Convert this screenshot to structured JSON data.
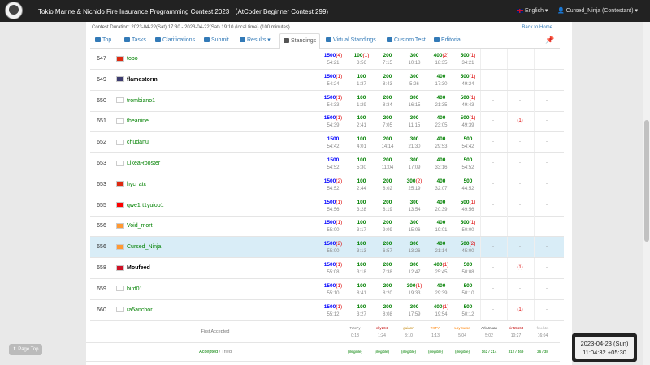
{
  "navbar": {
    "logo_text": "AtCoder",
    "title": "Tokio Marine & Nichido Fire Insurance Programming Contest 2023 （AtCoder Beginner Contest 299)",
    "language": "English",
    "user": "Cursed_Ninja (Contestant)"
  },
  "contest": {
    "duration": "Contest Duration: 2023-04-22(Sat) 17:30 - 2023-04-22(Sat) 19:10 (local time) (100 minutes)",
    "back_home": "Back to Home"
  },
  "tabs": [
    {
      "label": "Top",
      "icon": "home-icon"
    },
    {
      "label": "Tasks",
      "icon": "tasks-icon"
    },
    {
      "label": "Clarifications",
      "icon": "question-icon"
    },
    {
      "label": "Submit",
      "icon": "send-icon"
    },
    {
      "label": "Results",
      "icon": "list-icon"
    },
    {
      "label": "Standings",
      "icon": "sort-icon"
    },
    {
      "label": "Virtual Standings",
      "icon": "sort-icon"
    },
    {
      "label": "Custom Test",
      "icon": "wrench-icon"
    },
    {
      "label": "Editorial",
      "icon": "book-icon"
    }
  ],
  "rows": [
    {
      "rank": "647",
      "name": "tobo",
      "color": "#008000",
      "flag": "#de2910",
      "total": "1500",
      "tpen": "(4)",
      "ttime": "54:21",
      "a": [
        "100",
        "(1)",
        "3:56"
      ],
      "b": [
        "200",
        "",
        "7:15"
      ],
      "c": [
        "300",
        "",
        "10:18"
      ],
      "d": [
        "400",
        "(2)",
        "18:35"
      ],
      "e": [
        "500",
        "(1)",
        "34:21"
      ],
      "ex": [
        "-",
        "-",
        "-"
      ]
    },
    {
      "rank": "649",
      "name": "flamestorm",
      "color": "#000000",
      "flag": "#3c3b6e",
      "total": "1500",
      "tpen": "(1)",
      "ttime": "54:24",
      "a": [
        "100",
        "",
        "1:37"
      ],
      "b": [
        "200",
        "",
        "8:43"
      ],
      "c": [
        "300",
        "",
        "5:26"
      ],
      "d": [
        "400",
        "",
        "17:30"
      ],
      "e": [
        "500",
        "(1)",
        "49:24"
      ],
      "ex": [
        "-",
        "-",
        "-"
      ]
    },
    {
      "rank": "650",
      "name": "trombiano1",
      "color": "#008000",
      "flag": "#ffffff",
      "total": "1500",
      "tpen": "(1)",
      "ttime": "54:33",
      "a": [
        "100",
        "",
        "1:29"
      ],
      "b": [
        "200",
        "",
        "8:34"
      ],
      "c": [
        "300",
        "",
        "16:15"
      ],
      "d": [
        "400",
        "",
        "21:35"
      ],
      "e": [
        "500",
        "(1)",
        "49:43"
      ],
      "ex": [
        "-",
        "-",
        "-"
      ]
    },
    {
      "rank": "651",
      "name": "theanine",
      "color": "#008000",
      "flag": "#ffffff",
      "total": "1500",
      "tpen": "(1)",
      "ttime": "54:39",
      "a": [
        "100",
        "",
        "2:41"
      ],
      "b": [
        "200",
        "",
        "7:05"
      ],
      "c": [
        "300",
        "",
        "11:15"
      ],
      "d": [
        "400",
        "",
        "23:05"
      ],
      "e": [
        "500",
        "(1)",
        "49:39"
      ],
      "ex": [
        "-",
        "(1)",
        "-"
      ]
    },
    {
      "rank": "652",
      "name": "chudanu",
      "color": "#008000",
      "flag": "#ffffff",
      "total": "1500",
      "tpen": "",
      "ttime": "54:42",
      "a": [
        "100",
        "",
        "4:01"
      ],
      "b": [
        "200",
        "",
        "14:14"
      ],
      "c": [
        "300",
        "",
        "21:30"
      ],
      "d": [
        "400",
        "",
        "29:53"
      ],
      "e": [
        "500",
        "",
        "54:42"
      ],
      "ex": [
        "-",
        "-",
        "-"
      ]
    },
    {
      "rank": "653",
      "name": "LikeaRooster",
      "color": "#008000",
      "flag": "#ffffff",
      "total": "1500",
      "tpen": "",
      "ttime": "54:52",
      "a": [
        "100",
        "",
        "5:30"
      ],
      "b": [
        "200",
        "",
        "11:04"
      ],
      "c": [
        "300",
        "",
        "17:09"
      ],
      "d": [
        "400",
        "",
        "33:16"
      ],
      "e": [
        "500",
        "",
        "54:52"
      ],
      "ex": [
        "-",
        "-",
        "-"
      ]
    },
    {
      "rank": "653",
      "name": "hyc_atc",
      "color": "#008000",
      "flag": "#de2910",
      "total": "1500",
      "tpen": "(2)",
      "ttime": "54:52",
      "a": [
        "100",
        "",
        "2:44"
      ],
      "b": [
        "200",
        "",
        "8:02"
      ],
      "c": [
        "300",
        "(2)",
        "25:19"
      ],
      "d": [
        "400",
        "",
        "32:07"
      ],
      "e": [
        "500",
        "",
        "44:52"
      ],
      "ex": [
        "-",
        "-",
        "-"
      ]
    },
    {
      "rank": "655",
      "name": "qwe1rt1yuiop1",
      "color": "#008000",
      "flag": "#fe0000",
      "total": "1500",
      "tpen": "(1)",
      "ttime": "54:56",
      "a": [
        "100",
        "",
        "3:28"
      ],
      "b": [
        "200",
        "",
        "8:19"
      ],
      "c": [
        "300",
        "",
        "13:54"
      ],
      "d": [
        "400",
        "",
        "20:39"
      ],
      "e": [
        "500",
        "(1)",
        "49:56"
      ],
      "ex": [
        "-",
        "-",
        "-"
      ]
    },
    {
      "rank": "656",
      "name": "Void_mort",
      "color": "#008000",
      "flag": "#ff9933",
      "total": "1500",
      "tpen": "(1)",
      "ttime": "55:00",
      "a": [
        "100",
        "",
        "3:17"
      ],
      "b": [
        "200",
        "",
        "9:09"
      ],
      "c": [
        "300",
        "",
        "15:06"
      ],
      "d": [
        "400",
        "",
        "19:01"
      ],
      "e": [
        "500",
        "(1)",
        "50:00"
      ],
      "ex": [
        "-",
        "-",
        "-"
      ]
    },
    {
      "rank": "656",
      "name": "Cursed_Ninja",
      "color": "#008000",
      "flag": "#ff9933",
      "me": true,
      "total": "1500",
      "tpen": "(2)",
      "ttime": "55:00",
      "a": [
        "100",
        "",
        "3:13"
      ],
      "b": [
        "200",
        "",
        "6:57"
      ],
      "c": [
        "300",
        "",
        "13:26"
      ],
      "d": [
        "400",
        "",
        "21:14"
      ],
      "e": [
        "500",
        "(2)",
        "45:00"
      ],
      "ex": [
        "-",
        "-",
        "-"
      ]
    },
    {
      "rank": "658",
      "name": "Moufeed",
      "color": "#000000",
      "flag": "#ce1126",
      "total": "1500",
      "tpen": "(1)",
      "ttime": "55:08",
      "a": [
        "100",
        "",
        "3:18"
      ],
      "b": [
        "200",
        "",
        "7:38"
      ],
      "c": [
        "300",
        "",
        "12:47"
      ],
      "d": [
        "400",
        "(1)",
        "25:45"
      ],
      "e": [
        "500",
        "",
        "50:08"
      ],
      "ex": [
        "-",
        "(1)",
        "-"
      ]
    },
    {
      "rank": "659",
      "name": "bird01",
      "color": "#008000",
      "flag": "#ffffff",
      "total": "1500",
      "tpen": "(1)",
      "ttime": "55:10",
      "a": [
        "100",
        "",
        "8:41"
      ],
      "b": [
        "200",
        "",
        "8:20"
      ],
      "c": [
        "300",
        "(1)",
        "19:33"
      ],
      "d": [
        "400",
        "",
        "29:39"
      ],
      "e": [
        "500",
        "",
        "50:10"
      ],
      "ex": [
        "-",
        "-",
        "-"
      ]
    },
    {
      "rank": "660",
      "name": "ra5anchor",
      "color": "#008000",
      "flag": "#ffffff",
      "total": "1500",
      "tpen": "(1)",
      "ttime": "55:12",
      "a": [
        "100",
        "",
        "3:27"
      ],
      "b": [
        "200",
        "",
        "8:08"
      ],
      "c": [
        "300",
        "",
        "17:59"
      ],
      "d": [
        "400",
        "(1)",
        "19:54"
      ],
      "e": [
        "500",
        "",
        "50:12"
      ],
      "ex": [
        "-",
        "(1)",
        "-"
      ]
    }
  ],
  "first_accepted": {
    "label": "First Accepted",
    "items": [
      {
        "name": "TZoPy",
        "time": "0:18",
        "color": "#808080"
      },
      {
        "name": "cky204",
        "time": "1:24",
        "color": "#c00000"
      },
      {
        "name": "guiann",
        "time": "3:10",
        "color": "#c08000"
      },
      {
        "name": "TXTYI",
        "time": "1:13",
        "color": "#ff8000"
      },
      {
        "name": "LayCurse",
        "time": "5:04",
        "color": "#ff8000"
      },
      {
        "name": "ArkUnoan",
        "time": "5:02",
        "color": "#333333"
      },
      {
        "name": "hiri55563",
        "time": "10:27",
        "color": "#c00000"
      },
      {
        "name": "fuu.h11",
        "time": "16:04",
        "color": "#aaaaaa"
      }
    ]
  },
  "accepted_tried": {
    "label_accepted": "Accepted",
    "label_sep": " / Tried",
    "items": [
      "(illegible)",
      "(illegible)",
      "(illegible)",
      "(illegible)",
      "(illegible)",
      "162 / 214",
      "312 / 469",
      "26 / 38"
    ]
  },
  "page_top": "Page Top",
  "clock": {
    "date": "2023-04-23 (Sun)",
    "time": "11:04:32 +05:30"
  }
}
